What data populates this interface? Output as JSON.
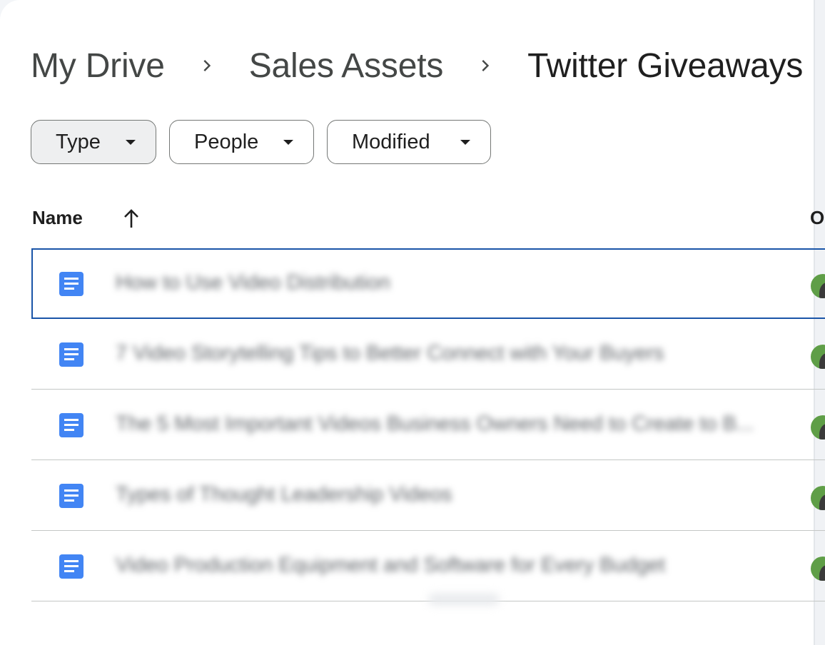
{
  "breadcrumb": {
    "root": "My Drive",
    "parent": "Sales Assets",
    "current": "Twitter Giveaways"
  },
  "filters": {
    "type_label": "Type",
    "people_label": "People",
    "modified_label": "Modified"
  },
  "columns": {
    "name": "Name",
    "owner": "O"
  },
  "files": [
    {
      "title": "How to Use Video Distribution",
      "icon": "google-docs-icon",
      "selected": true
    },
    {
      "title": "7 Video Storytelling Tips to Better Connect with Your Buyers",
      "icon": "google-docs-icon",
      "selected": false
    },
    {
      "title": "The 5 Most Important Videos Business Owners Need to Create to B...",
      "icon": "google-docs-icon",
      "selected": false
    },
    {
      "title": "Types of Thought Leadership Videos",
      "icon": "google-docs-icon",
      "selected": false
    },
    {
      "title": "Video Production Equipment and Software for Every Budget",
      "icon": "google-docs-icon",
      "selected": false
    }
  ],
  "colors": {
    "accent": "#1a55a8",
    "doc_icon": "#4285f4",
    "owner_avatar": "#5f9e47"
  }
}
